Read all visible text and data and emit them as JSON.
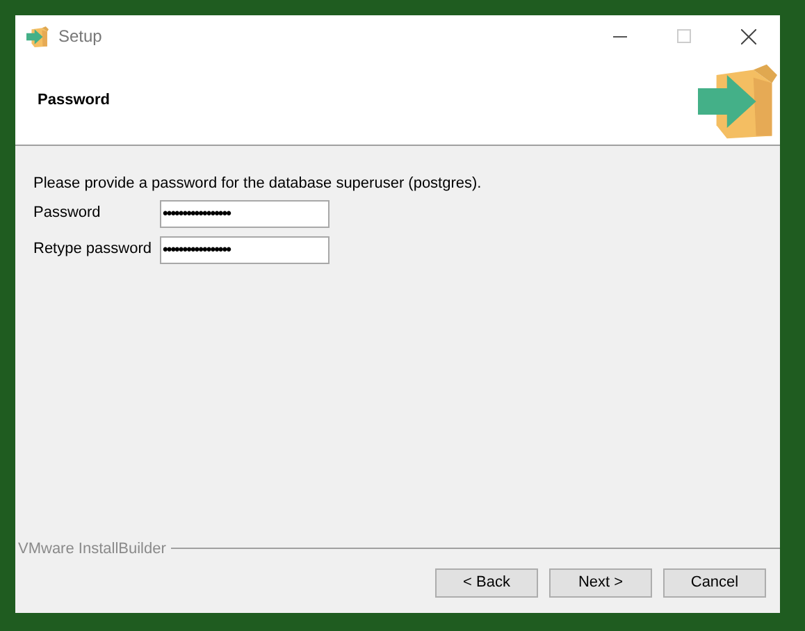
{
  "window": {
    "title": "Setup"
  },
  "header": {
    "title": "Password"
  },
  "instruction": "Please provide a password for the database superuser (postgres).",
  "fields": [
    {
      "label": "Password",
      "value": "•••••••••••••••••"
    },
    {
      "label": "Retype password",
      "value": "•••••••••••••••••"
    }
  ],
  "footer": {
    "brand": "VMware InstallBuilder"
  },
  "buttons": [
    "< Back",
    "Next >",
    "Cancel"
  ]
}
